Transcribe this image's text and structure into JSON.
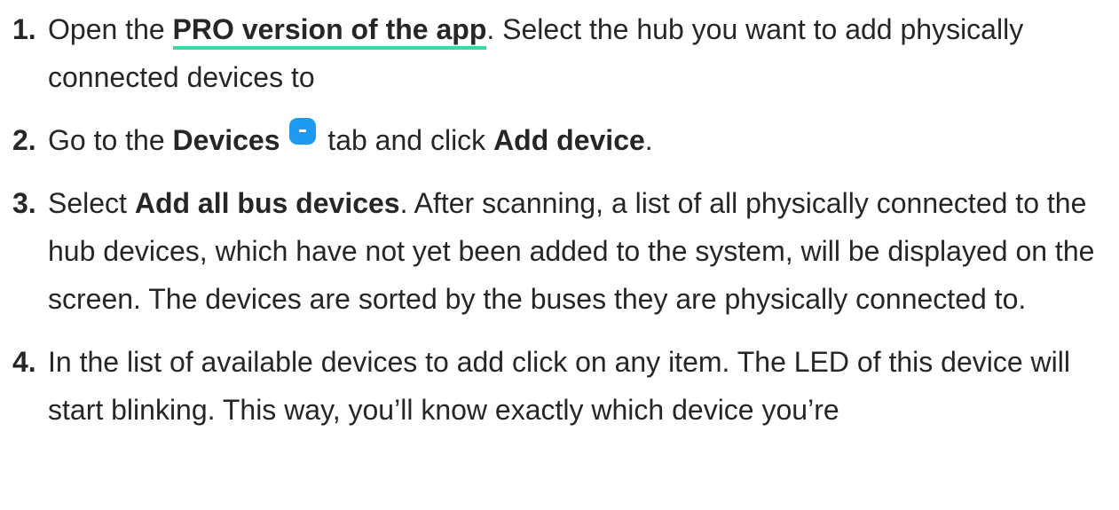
{
  "steps": [
    {
      "number": "1.",
      "parts": {
        "t1": "Open the ",
        "link": "PRO version of the app",
        "t2": ". Select the hub you want to add physically connected devices to"
      }
    },
    {
      "number": "2.",
      "parts": {
        "t1": "Go to the ",
        "b1": "Devices",
        "icon": "devices-tab-icon",
        "t2": " tab and click ",
        "b2": "Add device",
        "t3": "."
      }
    },
    {
      "number": "3.",
      "parts": {
        "t1": "Select ",
        "b1": "Add all bus devices",
        "t2": ". After scanning, a list of all physically connected to the hub devices, which have not yet been added to the system, will be displayed on the screen. The devices are sorted by the buses they are physically connected to."
      }
    },
    {
      "number": "4.",
      "parts": {
        "t1": "In the list of available devices to add click on any item. The LED of this device will start blinking. This way, you’ll know exactly which device you’re"
      }
    }
  ],
  "colors": {
    "text": "#262626",
    "link_underline": "#3fd6a4",
    "icon": "#1e9bf0"
  }
}
